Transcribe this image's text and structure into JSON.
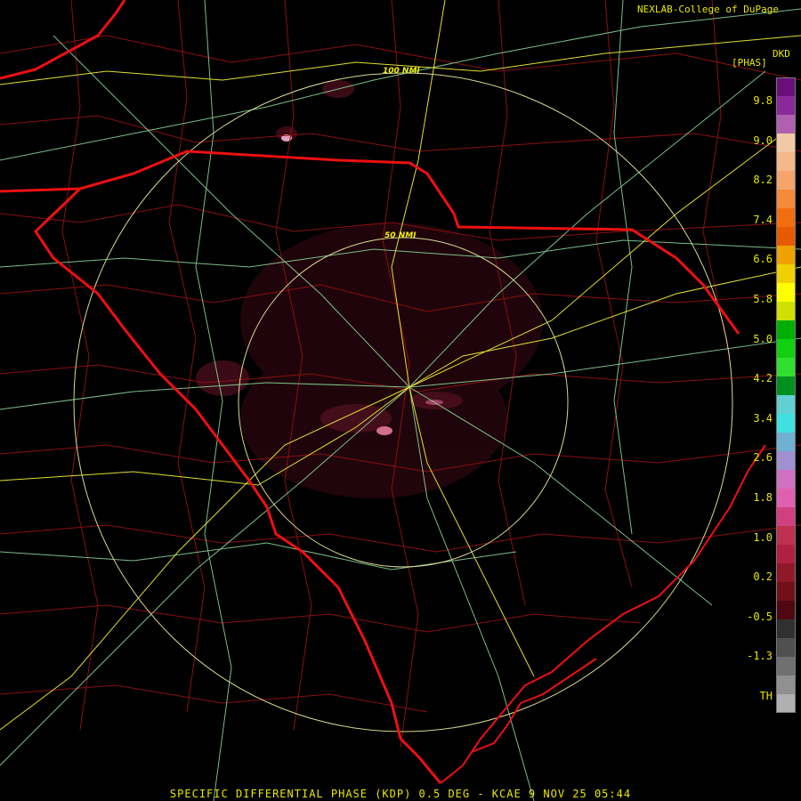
{
  "header": {
    "credit": "NEXLAB-College of DuPage",
    "station": "DKD",
    "units": "[PHAS]"
  },
  "range_rings": [
    "100 NMI",
    "50 NMI"
  ],
  "color_scale": {
    "labels": [
      "9.8",
      "9.0",
      "8.2",
      "7.4",
      "6.6",
      "5.8",
      "5.0",
      "4.2",
      "3.4",
      "2.6",
      "1.8",
      "1.0",
      "0.2",
      "-0.5",
      "-1.3",
      "TH"
    ],
    "colors": [
      "#6a0f7a",
      "#8a2a9a",
      "#b060b0",
      "#f2c9a5",
      "#f6b78a",
      "#f5a46c",
      "#f48a3a",
      "#f06e10",
      "#e85a00",
      "#f0a000",
      "#f0d000",
      "#ffff00",
      "#d0e000",
      "#00b000",
      "#10d010",
      "#30e030",
      "#009020",
      "#60d0d0",
      "#40e0e0",
      "#70b0d0",
      "#a090d0",
      "#d070c0",
      "#e060b0",
      "#d04080",
      "#c03050",
      "#b02040",
      "#901828",
      "#701018",
      "#500810",
      "#303030",
      "#505050",
      "#707070",
      "#909090",
      "#b0b0b0"
    ]
  },
  "footer": "SPECIFIC DIFFERENTIAL PHASE (KDP) 0.5 DEG - KCAE 9 NOV 25 05:44"
}
